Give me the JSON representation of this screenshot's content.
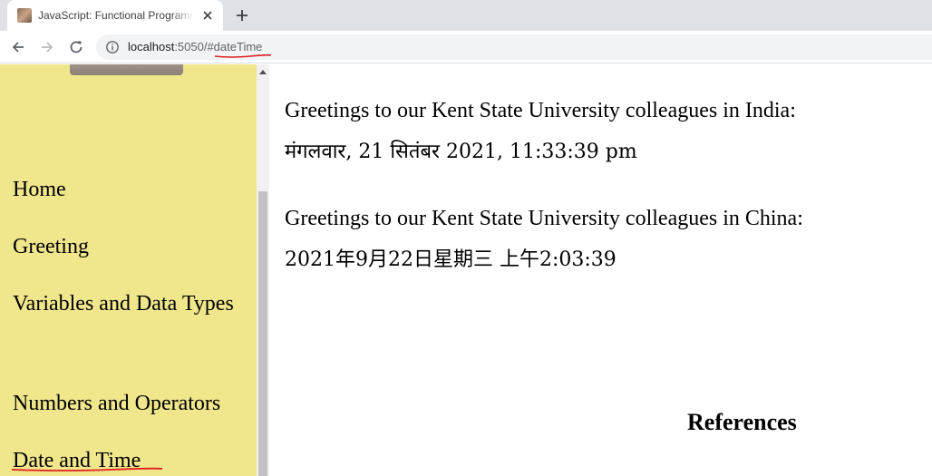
{
  "browser": {
    "tab": {
      "title": "JavaScript: Functional Programming",
      "favicon": "portrait-favicon",
      "close_icon": "close-icon"
    },
    "new_tab_icon": "plus-icon",
    "nav": {
      "back_icon": "back-arrow-icon",
      "forward_icon": "forward-arrow-icon",
      "reload_icon": "reload-icon"
    },
    "address": {
      "info_icon": "info-icon",
      "host": "localhost",
      "rest": ":5050/#dateTime"
    }
  },
  "sidebar": {
    "background": "#f0e68c",
    "items": [
      {
        "label": "Home"
      },
      {
        "label": "Greeting"
      },
      {
        "label": "Variables and Data Types"
      },
      {
        "label": "Numbers and Operators"
      },
      {
        "label": "Date and Time"
      }
    ]
  },
  "main": {
    "india_greeting": "Greetings to our Kent State University colleagues in India:",
    "india_datetime": "मंगलवार, 21 सितंबर 2021, 11:33:39 pm",
    "china_greeting": "Greetings to our Kent State University colleagues in China:",
    "china_datetime": "2021年9月22日星期三 上午2:03:39",
    "references_heading": "References"
  },
  "annotation_color": "#e02020"
}
